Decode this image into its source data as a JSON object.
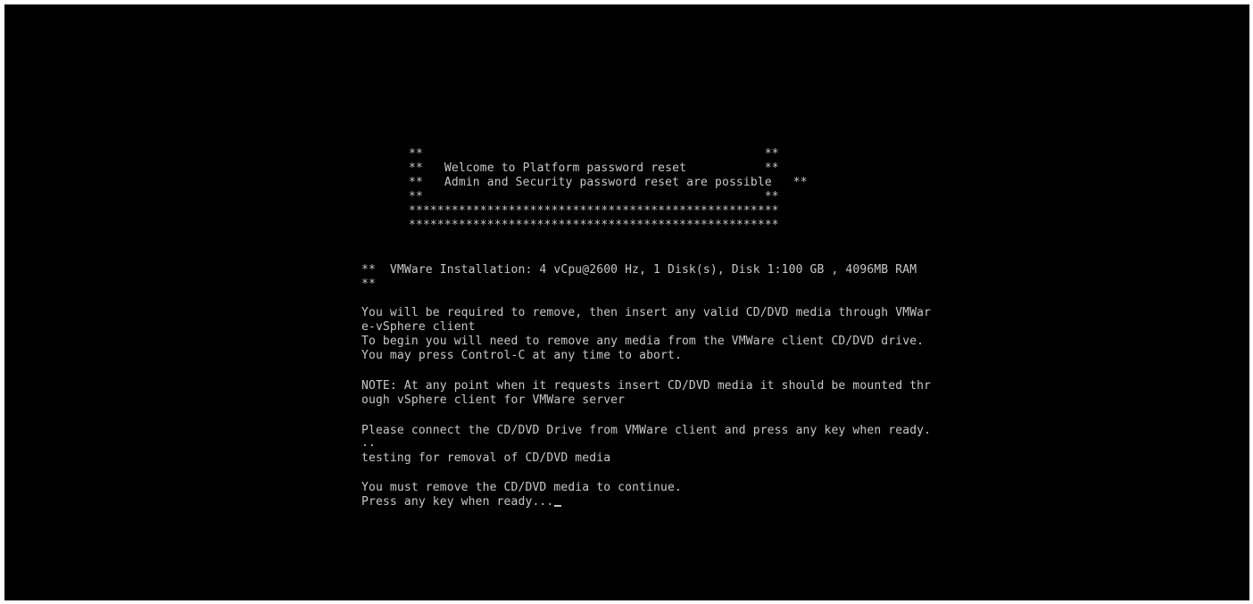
{
  "banner": {
    "lines": [
      "**                                                **",
      "**   Welcome to Platform password reset           **",
      "**   Admin and Security password reset are possible   **",
      "**                                                **",
      "****************************************************",
      "****************************************************"
    ]
  },
  "console": {
    "vmware_info": "**  VMWare Installation: 4 vCpu@2600 Hz, 1 Disk(s), Disk 1:100 GB , 4096MB RAM",
    "vmware_info_cont": "**",
    "remove_line_1": "You will be required to remove, then insert any valid CD/DVD media through VMWar",
    "remove_line_2": "e-vSphere client",
    "begin_line": "To begin you will need to remove any media from the VMWare client CD/DVD drive.",
    "abort_line": "You may press Control-C at any time to abort.",
    "note_line_1": "NOTE: At any point when it requests insert CD/DVD media it should be mounted thr",
    "note_line_2": "ough vSphere client for VMWare server",
    "connect_line": "Please connect the CD/DVD Drive from VMWare client and press any key when ready.",
    "dots_line": "..",
    "testing_line": "testing for removal of CD/DVD media",
    "must_remove_line": "You must remove the CD/DVD media to continue.",
    "prompt_line": "Press any key when ready...",
    "text_color": "#c8c8c8",
    "background_color": "#000000"
  }
}
